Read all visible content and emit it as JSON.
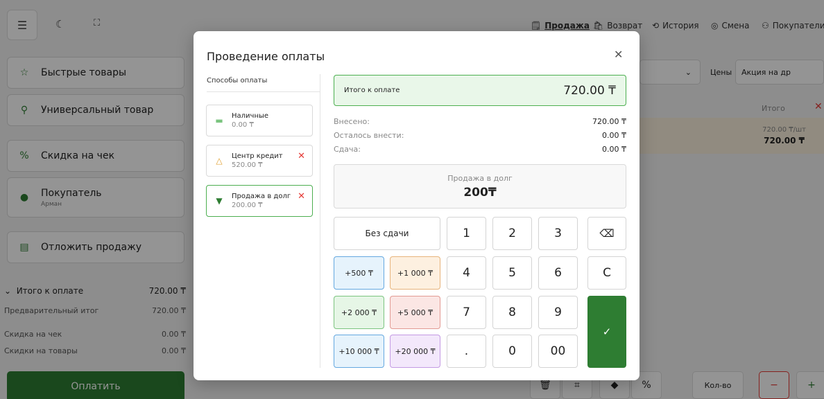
{
  "colors": {
    "primary": "#2e7d32",
    "accent_green": "#4caf50",
    "danger": "#e53935",
    "highlight_row": "#faf0dc"
  },
  "top_nav": [
    {
      "label": "Продажа",
      "icon": "receipt-icon",
      "active": true
    },
    {
      "label": "Возврат",
      "icon": "return-bag-icon",
      "active": false
    },
    {
      "label": "История",
      "icon": "history-icon",
      "active": false
    },
    {
      "label": "Смена",
      "icon": "shift-icon",
      "active": false
    },
    {
      "label": "Покупатели",
      "icon": "customers-icon",
      "active": false
    }
  ],
  "sidebar": {
    "quick_products": "Быстрые товары",
    "universal_product": "Универсальный товар",
    "check_discount": "Скидка на чек",
    "customer": "Покупатель",
    "customer_name": "Арман",
    "postpone_sale": "Отложить продажу"
  },
  "totals": {
    "to_pay_label": "Итого к оплате",
    "to_pay_value": "720.00 ₸",
    "preliminary_label": "Предварительный итог",
    "preliminary_value": "720.00 ₸",
    "check_discount_label": "Скидка на чек",
    "check_discount_value": "0.00 ₸",
    "product_discounts_label": "Скидки на товары",
    "product_discounts_value": "0.00 ₸"
  },
  "pay_button": "Оплатить",
  "right_panel": {
    "prices_label": "Цены",
    "promo_value": "Акция на др",
    "itogo_header": "Итого",
    "row_unit_price": "720.00 ₸/шт",
    "row_total": "720.00 ₸",
    "qty_label": "Кол-во"
  },
  "modal": {
    "title": "Проведение оплаты",
    "methods_header": "Способы оплаты",
    "methods": [
      {
        "name": "Наличные",
        "amount": "0.00 ₸",
        "removable": false,
        "selected": false
      },
      {
        "name": "Центр кредит",
        "amount": "520.00 ₸",
        "removable": true,
        "selected": false
      },
      {
        "name": "Продажа в долг",
        "amount": "200.00 ₸",
        "removable": true,
        "selected": true
      }
    ],
    "total_label": "Итого к оплате",
    "total_value": "720.00 ₸",
    "paid_label": "Внесено:",
    "paid_value": "720.00 ₸",
    "remaining_label": "Осталось внести:",
    "remaining_value": "0.00 ₸",
    "change_label": "Сдача:",
    "change_value": "0.00 ₸",
    "debt_label": "Продажа в долг",
    "debt_value": "200₸",
    "no_change": "Без сдачи",
    "quick_amounts": [
      "+500 ₸",
      "+1 000 ₸",
      "+2 000 ₸",
      "+5 000 ₸",
      "+10 000 ₸",
      "+20 000 ₸"
    ],
    "keys": [
      "1",
      "2",
      "3",
      "4",
      "5",
      "6",
      "7",
      "8",
      "9",
      ".",
      "0",
      "00"
    ],
    "clear_key": "C"
  }
}
